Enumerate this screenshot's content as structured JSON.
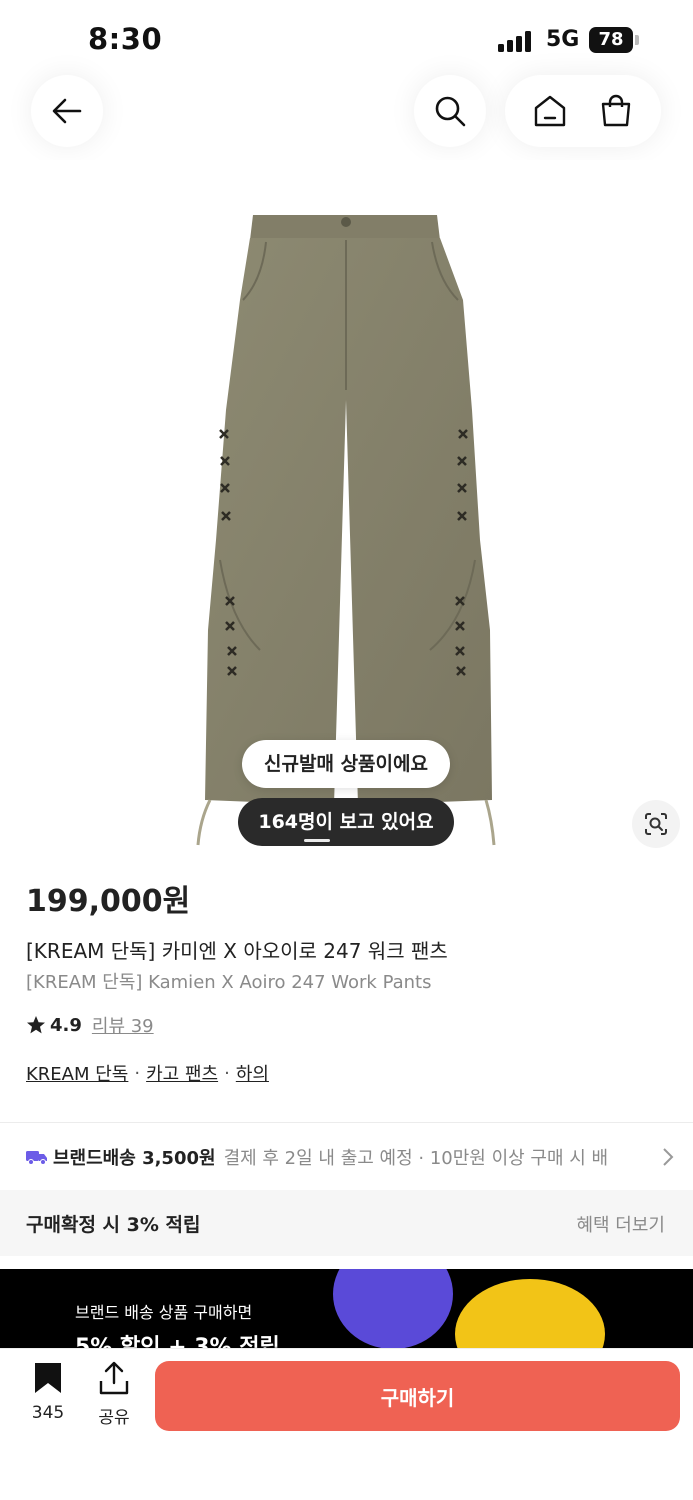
{
  "status_bar": {
    "time": "8:30",
    "network": "5G",
    "battery": "78"
  },
  "nav": {
    "back_icon": "arrow-left-icon",
    "search_icon": "search-icon",
    "home_icon": "home-icon",
    "bag_icon": "shopping-bag-icon"
  },
  "gallery": {
    "badge_new": "신규발매 상품이에요",
    "badge_viewers": "164명이 보고 있어요"
  },
  "product": {
    "price": "199,000원",
    "name_ko": "[KREAM 단독] 카미엔 X 아오이로 247 워크 팬츠",
    "name_en": "[KREAM 단독] Kamien X Aoiro 247 Work Pants",
    "rating": "4.9",
    "review_label": "리뷰 39",
    "tags": [
      "KREAM 단독",
      "카고 팬츠",
      "하의"
    ]
  },
  "shipping": {
    "label": "브랜드배송 3,500원",
    "detail": "결제 후 2일 내 출고 예정 · 10만원 이상 구매 시 배",
    "accent_color": "#6c5ce7"
  },
  "benefit": {
    "text": "구매확정 시 3% 적립",
    "link": "혜택 더보기"
  },
  "promo": {
    "text": "브랜드 배송 상품 구매하면",
    "big": "5% 할인 + 3% 적립"
  },
  "bottom_bar": {
    "bookmark_count": "345",
    "share_label": "공유",
    "buy_label": "구매하기",
    "buy_color": "#ef6253"
  }
}
